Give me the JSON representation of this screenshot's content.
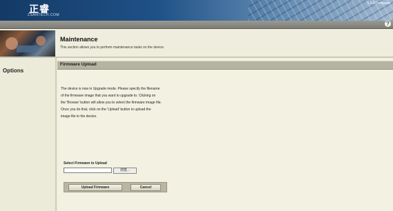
{
  "banner": {
    "logo_text": "正睿",
    "logo_sub": "ZSANTECH.COM",
    "firmware_version": "1.0.0 Firmware"
  },
  "header": {
    "help_icon_glyph": "?",
    "title": "Maintenance",
    "subtitle": "This section allows you to perform maintenance tasks on the device."
  },
  "sidebar": {
    "options_label": "Options"
  },
  "section": {
    "title": "Firmware Upload",
    "description_lines": [
      "The device is now in Upgrade mode. Please specify the filename",
      "of the firmware image that you want to upgrade to. Clicking on",
      "the 'Browse' button will allow you to select the firmware image file.",
      "Once you do that, click on the 'Upload' button to upload the",
      "image file to the device."
    ],
    "select_label": "Select Firmware to Upload",
    "file_input_value": "",
    "browse_label": "浏览...",
    "upload_button": "Upload Firmware",
    "cancel_button": "Cancel"
  },
  "colors": {
    "banner_dark": "#143a66",
    "page_bg": "#ecebd9",
    "section_bar": "#b5b3a1"
  }
}
